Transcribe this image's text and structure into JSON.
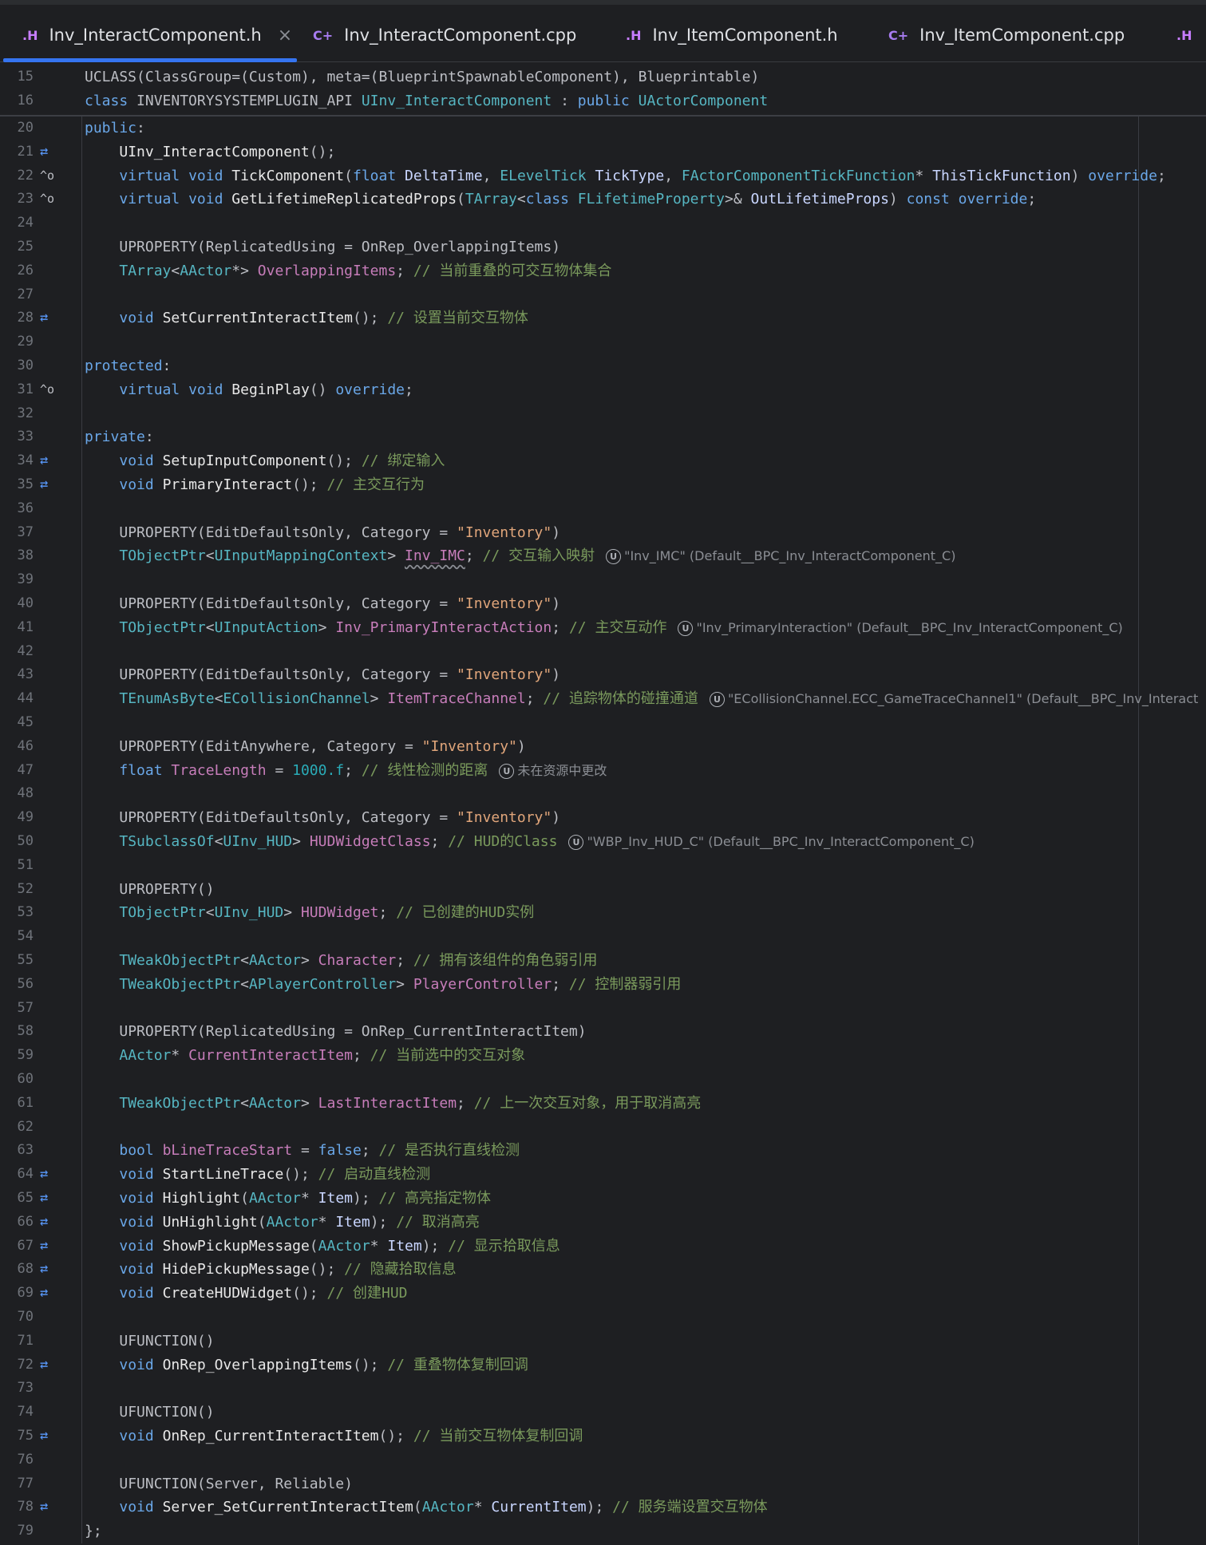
{
  "tabs": [
    {
      "icon": ".H",
      "label": "Inv_InteractComponent.h",
      "active": true,
      "close": "×"
    },
    {
      "icon": "C+",
      "label": "Inv_InteractComponent.cpp",
      "active": false
    },
    {
      "icon": ".H",
      "label": "Inv_ItemComponent.h",
      "active": false
    },
    {
      "icon": "C+",
      "label": "Inv_ItemComponent.cpp",
      "active": false
    },
    {
      "icon": ".H",
      "label": "",
      "active": false
    }
  ],
  "sticky_lines": [
    {
      "num": "15",
      "text": "UCLASS(ClassGroup=(Custom), meta=(BlueprintSpawnableComponent), Blueprintable)"
    },
    {
      "num": "16",
      "text": "class INVENTORYSYSTEMPLUGIN_API UInv_InteractComponent : public UActorComponent"
    }
  ],
  "lines": [
    {
      "num": "20",
      "gutter": "",
      "text": "public:"
    },
    {
      "num": "21",
      "gutter": "⇄",
      "text": "    UInv_InteractComponent();"
    },
    {
      "num": "22",
      "gutter": "^o",
      "text": "    virtual void TickComponent(float DeltaTime, ELevelTick TickType, FActorComponentTickFunction* ThisTickFunction) override;"
    },
    {
      "num": "23",
      "gutter": "^o",
      "text": "    virtual void GetLifetimeReplicatedProps(TArray<class FLifetimeProperty>& OutLifetimeProps) const override;"
    },
    {
      "num": "24",
      "gutter": "",
      "text": ""
    },
    {
      "num": "25",
      "gutter": "",
      "text": "    UPROPERTY(ReplicatedUsing = OnRep_OverlappingItems)"
    },
    {
      "num": "26",
      "gutter": "",
      "text": "    TArray<AActor*> OverlappingItems; // 当前重叠的可交互物体集合"
    },
    {
      "num": "27",
      "gutter": "",
      "text": ""
    },
    {
      "num": "28",
      "gutter": "⇄",
      "text": "    void SetCurrentInteractItem(); // 设置当前交互物体"
    },
    {
      "num": "29",
      "gutter": "",
      "text": ""
    },
    {
      "num": "30",
      "gutter": "",
      "text": "protected:"
    },
    {
      "num": "31",
      "gutter": "^o",
      "text": "    virtual void BeginPlay() override;"
    },
    {
      "num": "32",
      "gutter": "",
      "text": ""
    },
    {
      "num": "33",
      "gutter": "",
      "text": "private:"
    },
    {
      "num": "34",
      "gutter": "⇄",
      "text": "    void SetupInputComponent(); // 绑定输入"
    },
    {
      "num": "35",
      "gutter": "⇄",
      "text": "    void PrimaryInteract(); // 主交互行为"
    },
    {
      "num": "36",
      "gutter": "",
      "text": ""
    },
    {
      "num": "37",
      "gutter": "",
      "text": "    UPROPERTY(EditDefaultsOnly, Category = \"Inventory\")"
    },
    {
      "num": "38",
      "gutter": "",
      "text": "    TObjectPtr<UInputMappingContext> Inv_IMC; // 交互输入映射",
      "hint": "\"Inv_IMC\" (Default__BPC_Inv_InteractComponent_C)"
    },
    {
      "num": "39",
      "gutter": "",
      "text": ""
    },
    {
      "num": "40",
      "gutter": "",
      "text": "    UPROPERTY(EditDefaultsOnly, Category = \"Inventory\")"
    },
    {
      "num": "41",
      "gutter": "",
      "text": "    TObjectPtr<UInputAction> Inv_PrimaryInteractAction; // 主交互动作",
      "hint": "\"Inv_PrimaryInteraction\" (Default__BPC_Inv_InteractComponent_C)"
    },
    {
      "num": "42",
      "gutter": "",
      "text": ""
    },
    {
      "num": "43",
      "gutter": "",
      "text": "    UPROPERTY(EditDefaultsOnly, Category = \"Inventory\")"
    },
    {
      "num": "44",
      "gutter": "",
      "text": "    TEnumAsByte<ECollisionChannel> ItemTraceChannel; // 追踪物体的碰撞通道",
      "hint": "\"ECollisionChannel.ECC_GameTraceChannel1\" (Default__BPC_Inv_Interact"
    },
    {
      "num": "45",
      "gutter": "",
      "text": ""
    },
    {
      "num": "46",
      "gutter": "",
      "text": "    UPROPERTY(EditAnywhere, Category = \"Inventory\")"
    },
    {
      "num": "47",
      "gutter": "",
      "text": "    float TraceLength = 1000.f; // 线性检测的距离",
      "hint": "未在资源中更改"
    },
    {
      "num": "48",
      "gutter": "",
      "text": ""
    },
    {
      "num": "49",
      "gutter": "",
      "text": "    UPROPERTY(EditDefaultsOnly, Category = \"Inventory\")"
    },
    {
      "num": "50",
      "gutter": "",
      "text": "    TSubclassOf<UInv_HUD> HUDWidgetClass; // HUD的Class",
      "hint": "\"WBP_Inv_HUD_C\" (Default__BPC_Inv_InteractComponent_C)"
    },
    {
      "num": "51",
      "gutter": "",
      "text": ""
    },
    {
      "num": "52",
      "gutter": "",
      "text": "    UPROPERTY()"
    },
    {
      "num": "53",
      "gutter": "",
      "text": "    TObjectPtr<UInv_HUD> HUDWidget; // 已创建的HUD实例"
    },
    {
      "num": "54",
      "gutter": "",
      "text": ""
    },
    {
      "num": "55",
      "gutter": "",
      "text": "    TWeakObjectPtr<AActor> Character; // 拥有该组件的角色弱引用"
    },
    {
      "num": "56",
      "gutter": "",
      "text": "    TWeakObjectPtr<APlayerController> PlayerController; // 控制器弱引用"
    },
    {
      "num": "57",
      "gutter": "",
      "text": ""
    },
    {
      "num": "58",
      "gutter": "",
      "text": "    UPROPERTY(ReplicatedUsing = OnRep_CurrentInteractItem)"
    },
    {
      "num": "59",
      "gutter": "",
      "text": "    AActor* CurrentInteractItem; // 当前选中的交互对象"
    },
    {
      "num": "60",
      "gutter": "",
      "text": ""
    },
    {
      "num": "61",
      "gutter": "",
      "text": "    TWeakObjectPtr<AActor> LastInteractItem; // 上一次交互对象，用于取消高亮"
    },
    {
      "num": "62",
      "gutter": "",
      "text": ""
    },
    {
      "num": "63",
      "gutter": "",
      "text": "    bool bLineTraceStart = false; // 是否执行直线检测"
    },
    {
      "num": "64",
      "gutter": "⇄",
      "text": "    void StartLineTrace(); // 启动直线检测"
    },
    {
      "num": "65",
      "gutter": "⇄",
      "text": "    void Highlight(AActor* Item); // 高亮指定物体"
    },
    {
      "num": "66",
      "gutter": "⇄",
      "text": "    void UnHighlight(AActor* Item); // 取消高亮"
    },
    {
      "num": "67",
      "gutter": "⇄",
      "text": "    void ShowPickupMessage(AActor* Item); // 显示拾取信息"
    },
    {
      "num": "68",
      "gutter": "⇄",
      "text": "    void HidePickupMessage(); // 隐藏拾取信息"
    },
    {
      "num": "69",
      "gutter": "⇄",
      "text": "    void CreateHUDWidget(); // 创建HUD"
    },
    {
      "num": "70",
      "gutter": "",
      "text": ""
    },
    {
      "num": "71",
      "gutter": "",
      "text": "    UFUNCTION()"
    },
    {
      "num": "72",
      "gutter": "⇄",
      "text": "    void OnRep_OverlappingItems(); // 重叠物体复制回调"
    },
    {
      "num": "73",
      "gutter": "",
      "text": ""
    },
    {
      "num": "74",
      "gutter": "",
      "text": "    UFUNCTION()"
    },
    {
      "num": "75",
      "gutter": "⇄",
      "text": "    void OnRep_CurrentInteractItem(); // 当前交互物体复制回调"
    },
    {
      "num": "76",
      "gutter": "",
      "text": ""
    },
    {
      "num": "77",
      "gutter": "",
      "text": "    UFUNCTION(Server, Reliable)"
    },
    {
      "num": "78",
      "gutter": "⇄",
      "text": "    void Server_SetCurrentInteractItem(AActor* CurrentItem); // 服务端设置交互物体"
    },
    {
      "num": "79",
      "gutter": "",
      "text": "};"
    }
  ]
}
